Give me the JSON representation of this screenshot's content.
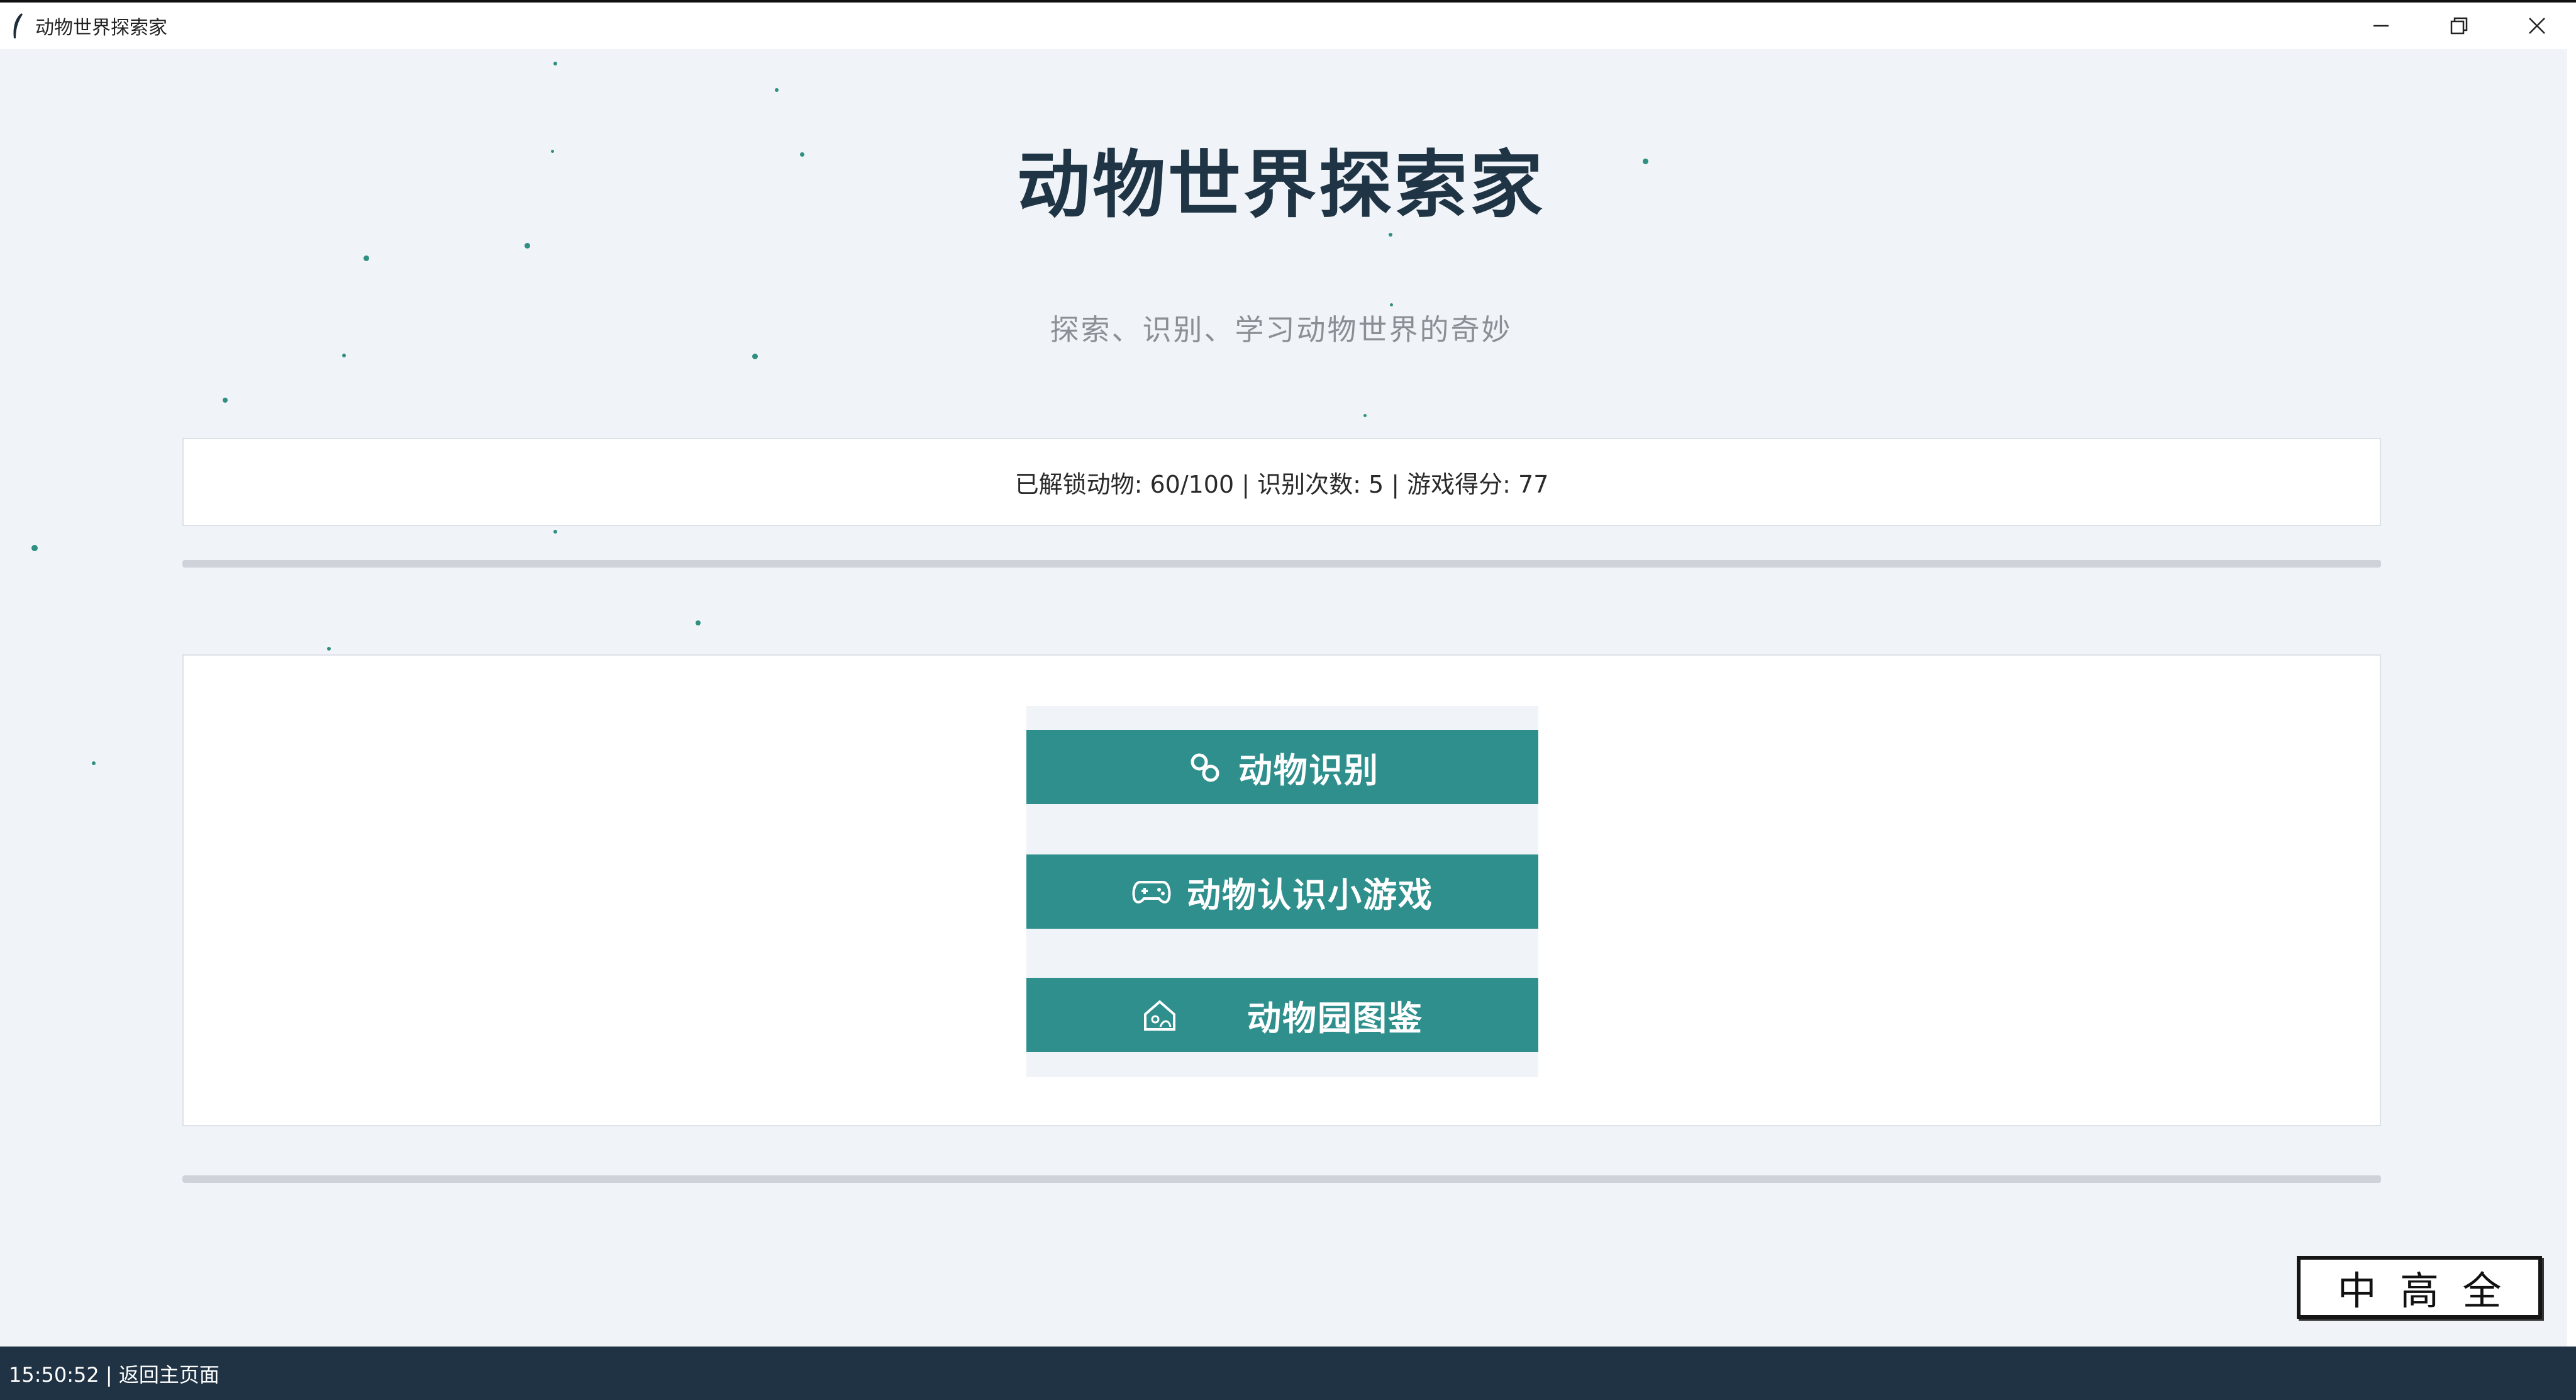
{
  "window": {
    "title": "动物世界探索家",
    "controls": [
      "minimize",
      "restore",
      "close"
    ]
  },
  "header": {
    "title": "动物世界探索家",
    "subtitle": "探索、识别、学习动物世界的奇妙"
  },
  "stats": {
    "text": "已解锁动物: 60/100 | 识别次数: 5 | 游戏得分: 77",
    "unlocked": 60,
    "total": 100,
    "recognitions": 5,
    "score": 77
  },
  "menu": {
    "buttons": [
      {
        "label": "动物识别",
        "icon": "paw-icon"
      },
      {
        "label": "动物认识小游戏",
        "icon": "gamepad-icon"
      },
      {
        "label": "动物园图鉴",
        "icon": "zoo-icon"
      }
    ]
  },
  "stamp": {
    "chars": [
      "中",
      "高",
      "全"
    ]
  },
  "statusbar": {
    "text": "15:50:52 | 返回主页面"
  },
  "colors": {
    "background": "#f0f3f8",
    "accent": "#2e8f8c",
    "title": "#1f3444",
    "statusbar": "#203344"
  }
}
